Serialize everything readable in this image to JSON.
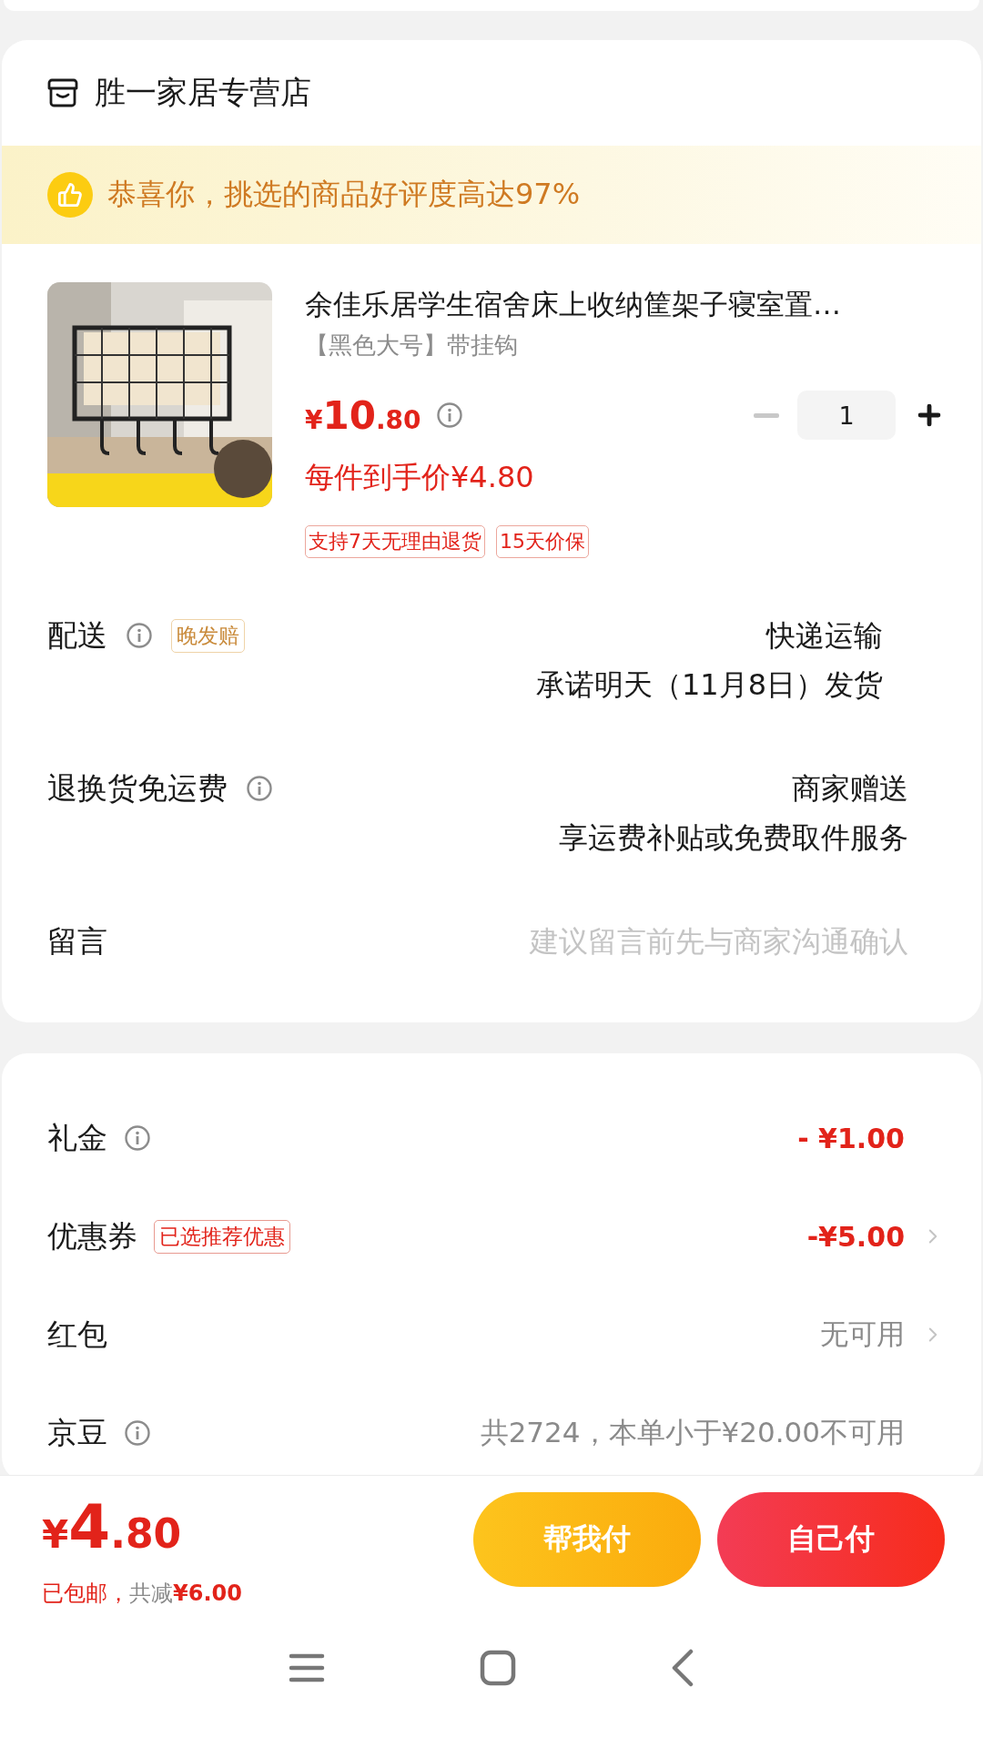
{
  "store": {
    "name": "胜一家居专营店"
  },
  "banner": {
    "text": "恭喜你，挑选的商品好评度高达97%"
  },
  "product": {
    "image": {
      "kind": "picture"
    },
    "title": "余佳乐居学生宿舍床上收纳筐架子寝室置…",
    "variant": "【黑色大号】带挂钩",
    "price": {
      "currency": "¥",
      "integer": "10",
      "decimal": ".80"
    },
    "net_price": "每件到手价¥4.80",
    "quantity": "1",
    "decrease_disabled": true,
    "tags": [
      "支持7天无理由退货",
      "15天价保"
    ]
  },
  "order_rows": [
    {
      "kind": "info",
      "label": "配送",
      "info": true,
      "badge": "晚发赔",
      "values": [
        "快递运输",
        "承诺明天（11月8日）发货"
      ]
    },
    {
      "kind": "info",
      "label": "退换货免运费",
      "info": true,
      "values": [
        "商家赠送",
        "享运费补贴或免费取件服务"
      ]
    },
    {
      "kind": "input",
      "label": "留言",
      "placeholder": "建议留言前先与商家沟通确认"
    }
  ],
  "discounts": [
    {
      "label": "礼金",
      "info": true,
      "value": "- ¥1.00",
      "highlight": true,
      "arrow": false
    },
    {
      "label": "优惠券",
      "info": false,
      "badge": "已选推荐优惠",
      "value": "-¥5.00",
      "highlight": true,
      "arrow": true
    },
    {
      "label": "红包",
      "info": false,
      "value": "无可用",
      "highlight": false,
      "arrow": true
    },
    {
      "label": "京豆",
      "info": true,
      "value": "共2724，本单小于¥20.00不可用",
      "highlight": false,
      "arrow": false
    }
  ],
  "footer": {
    "total": {
      "currency": "¥",
      "integer": "4",
      "decimal": ".80"
    },
    "summary": [
      {
        "kind": "notice",
        "text": "已包邮，"
      },
      {
        "kind": "label",
        "text": "共减"
      },
      {
        "kind": "amount",
        "text": "¥6.00"
      }
    ],
    "buttons": [
      {
        "kind": "secondary",
        "label": "帮我付"
      },
      {
        "kind": "primary",
        "label": "自己付"
      }
    ]
  }
}
